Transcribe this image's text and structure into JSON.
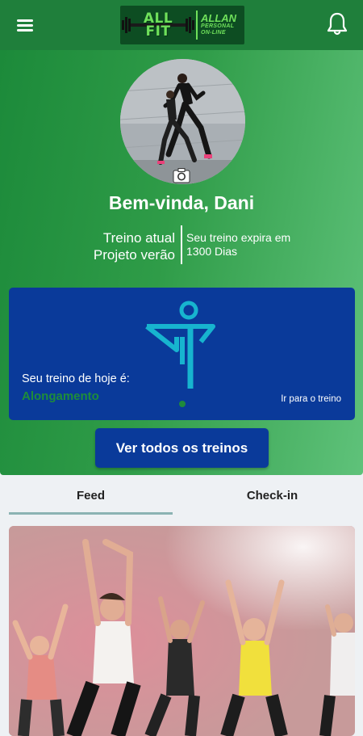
{
  "header": {
    "logo_text": "ALL FIT",
    "logo_sub_title": "ALLAN",
    "logo_sub_line1": "PERSONAL",
    "logo_sub_line2": "ON-LINE",
    "menu_icon": "menu-icon",
    "bell_icon": "bell-icon"
  },
  "profile": {
    "greeting": "Bem-vinda, Dani",
    "plan_label": "Treino atual",
    "plan_name": "Projeto verão",
    "expiry_line1": "Seu treino expira em",
    "expiry_line2": "1300 Dias"
  },
  "today": {
    "label": "Seu treino de hoje é:",
    "workout": "Alongamento",
    "link": "Ir para o treino"
  },
  "buttons": {
    "see_all": "Ver todos os treinos"
  },
  "tabs": [
    {
      "label": "Feed",
      "active": true
    },
    {
      "label": "Check-in",
      "active": false
    }
  ],
  "colors": {
    "brand_green": "#1f7f3b",
    "card_blue": "#0a3a9a",
    "accent_green": "#1e8d3a"
  }
}
